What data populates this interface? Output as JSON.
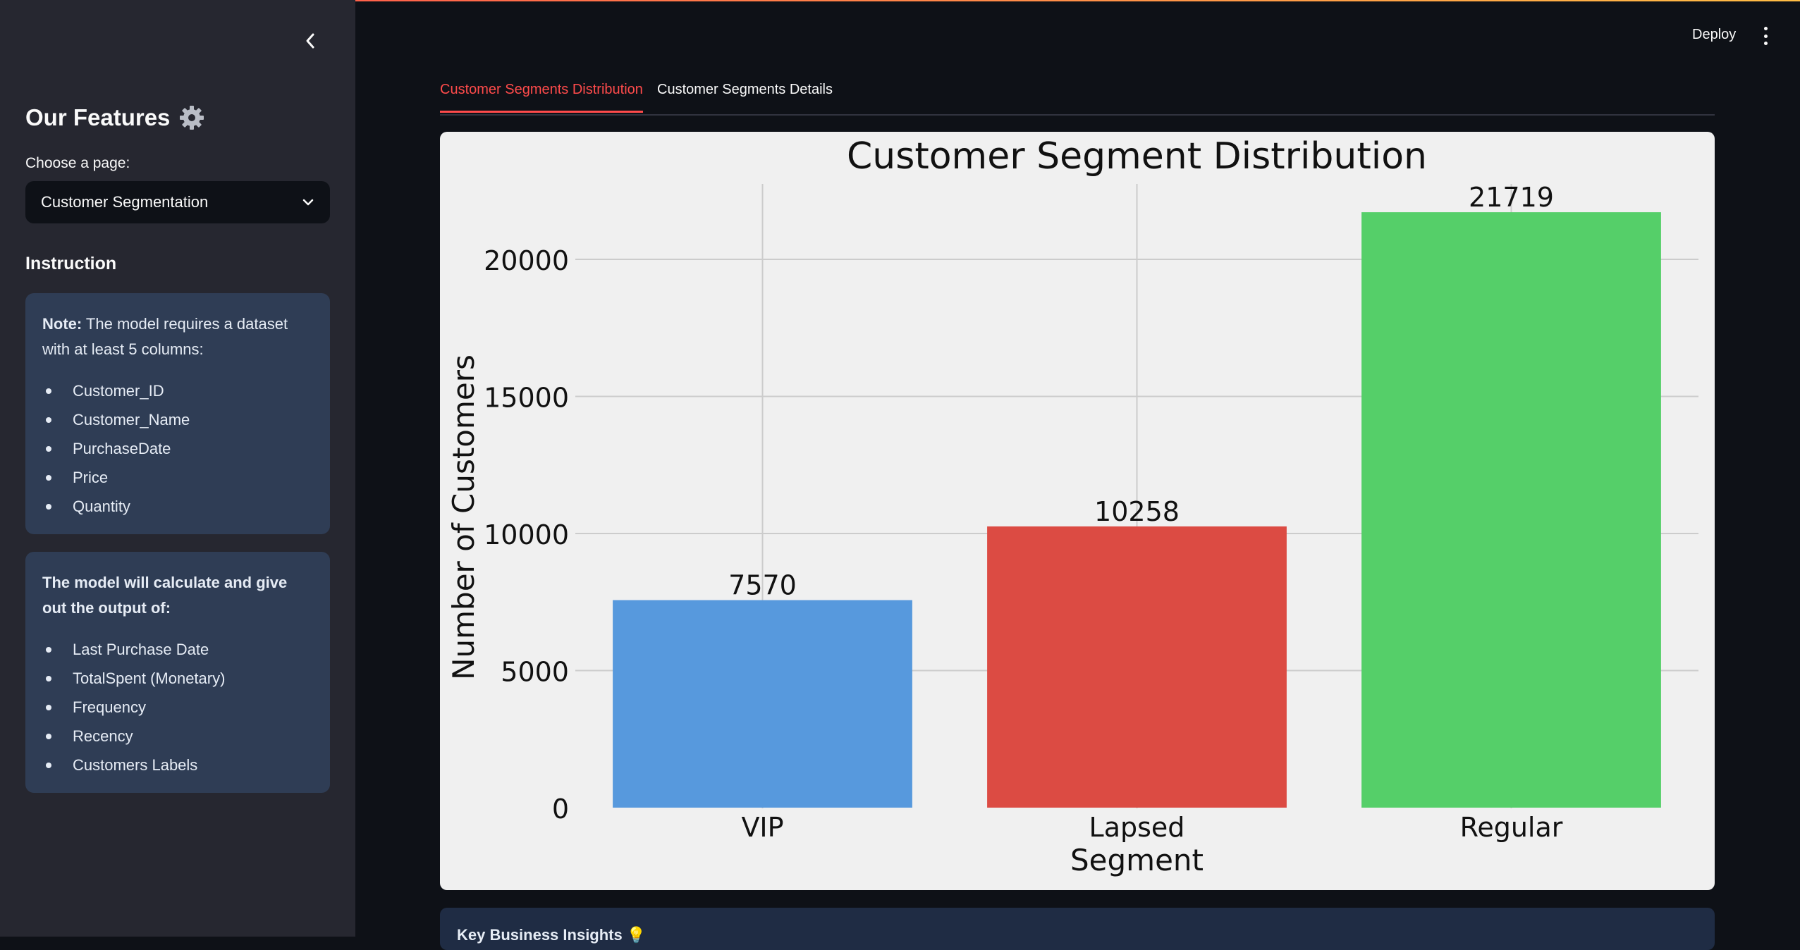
{
  "sidebar": {
    "title": "Our Features",
    "choose_label": "Choose a page:",
    "selected_page": "Customer Segmentation",
    "instruction_title": "Instruction",
    "card1": {
      "note_prefix": "Note:",
      "note_text": " The model requires a dataset with at least 5 columns:",
      "items": [
        "Customer_ID",
        "Customer_Name",
        "PurchaseDate",
        "Price",
        "Quantity"
      ]
    },
    "card2": {
      "text": "The model will calculate and give out the output of:",
      "items": [
        "Last Purchase Date",
        "TotalSpent (Monetary)",
        "Frequency",
        "Recency",
        "Customers Labels"
      ]
    }
  },
  "header": {
    "deploy_label": "Deploy"
  },
  "tabs": [
    {
      "label": "Customer Segments Distribution",
      "active": true
    },
    {
      "label": "Customer Segments Details",
      "active": false
    }
  ],
  "insights": {
    "title": "Key Business Insights 💡"
  },
  "chart_data": {
    "type": "bar",
    "title": "Customer Segment Distribution",
    "xlabel": "Segment",
    "ylabel": "Number of Customers",
    "categories": [
      "VIP",
      "Lapsed",
      "Regular"
    ],
    "values": [
      7570,
      10258,
      21719
    ],
    "colors": [
      "#5799dd",
      "#dc4b43",
      "#55cf69"
    ],
    "ylim": [
      0,
      22700
    ],
    "yticks": [
      0,
      5000,
      10000,
      15000,
      20000
    ],
    "grid": true,
    "background": "#f0f0f0"
  }
}
